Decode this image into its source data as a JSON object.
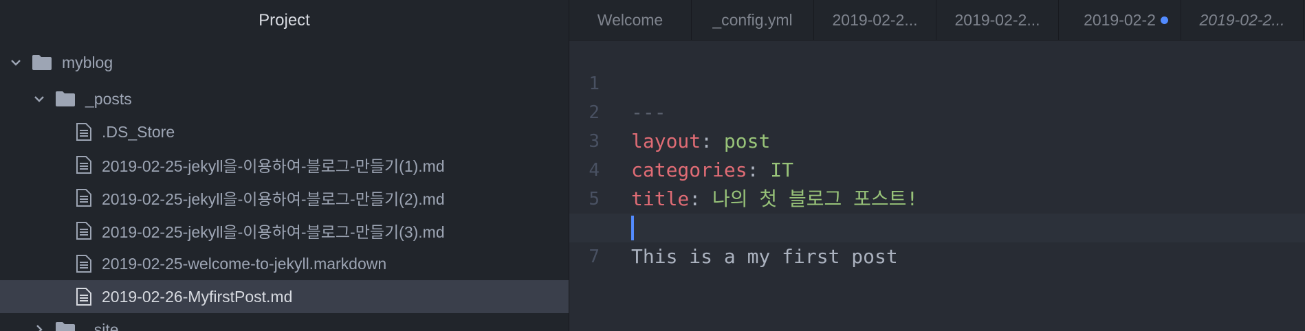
{
  "sidebar": {
    "title": "Project",
    "tree": [
      {
        "kind": "folder",
        "label": "myblog",
        "expanded": true
      },
      {
        "kind": "folder",
        "label": "_posts",
        "expanded": true
      },
      {
        "kind": "file",
        "label": ".DS_Store"
      },
      {
        "kind": "file",
        "label": "2019-02-25-jekyll을-이용하여-블로그-만들기(1).md"
      },
      {
        "kind": "file",
        "label": "2019-02-25-jekyll을-이용하여-블로그-만들기(2).md"
      },
      {
        "kind": "file",
        "label": "2019-02-25-jekyll을-이용하여-블로그-만들기(3).md"
      },
      {
        "kind": "file",
        "label": "2019-02-25-welcome-to-jekyll.markdown"
      },
      {
        "kind": "file",
        "label": "2019-02-26-MyfirstPost.md",
        "selected": true
      },
      {
        "kind": "folder",
        "label": "_site",
        "expanded": false
      }
    ]
  },
  "tabs": [
    {
      "label": "Welcome"
    },
    {
      "label": "_config.yml"
    },
    {
      "label": "2019-02-2..."
    },
    {
      "label": "2019-02-2..."
    },
    {
      "label": "2019-02-2",
      "modified": true
    },
    {
      "label": "2019-02-2...",
      "italic": true
    }
  ],
  "editor": {
    "lines": [
      {
        "num": "1",
        "dashes": "---"
      },
      {
        "num": "2",
        "key": "layout",
        "punc": ": ",
        "value": "post"
      },
      {
        "num": "3",
        "key": "categories",
        "punc": ": ",
        "value": "IT"
      },
      {
        "num": "4",
        "key": "title",
        "punc": ": ",
        "value": "나의 첫 블로그 포스트!"
      },
      {
        "num": "5",
        "dashes": "---"
      },
      {
        "num": "6",
        "text": "This is a my first post"
      },
      {
        "num": "7",
        "text": ""
      }
    ],
    "cursor_line": "7"
  },
  "colors": {
    "accent": "#528bff",
    "yaml_key": "#e06c75",
    "yaml_value": "#98c379",
    "comment": "#5c6370",
    "text": "#abb2bf"
  },
  "icons": {
    "folder": "folder-icon",
    "file": "file-text-icon",
    "expanded": "chevron-down-icon",
    "collapsed": "chevron-right-icon"
  }
}
